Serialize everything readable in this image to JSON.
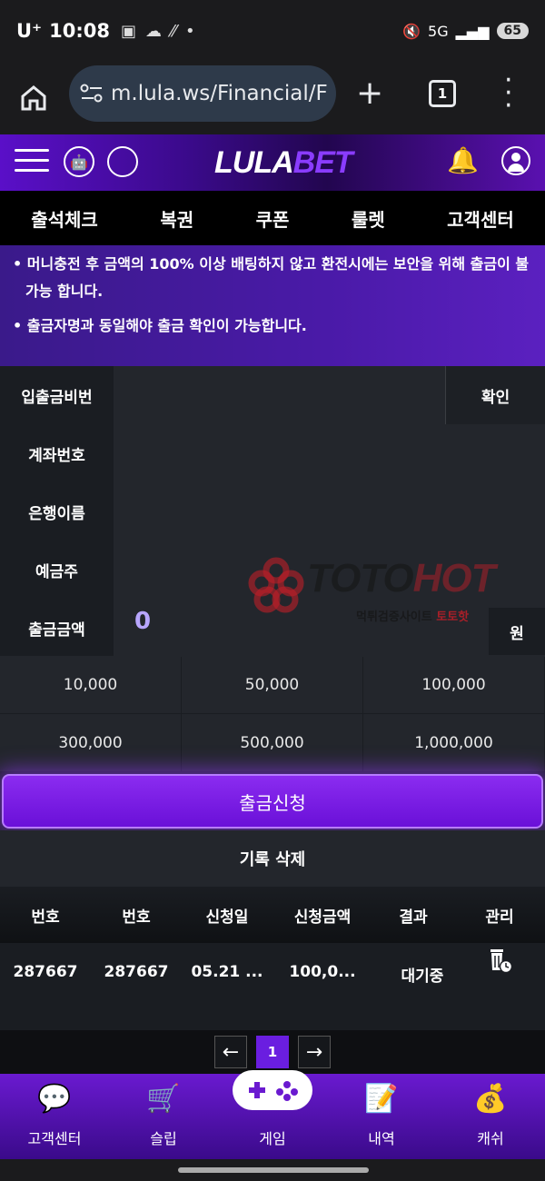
{
  "status": {
    "carrier": "U⁺",
    "time": "10:08",
    "network": "5G",
    "battery": "65"
  },
  "browser": {
    "url": "m.lula.ws/Financial/F",
    "tab_count": "1"
  },
  "header": {
    "logo_left": "LULA",
    "logo_right": "BET"
  },
  "nav": [
    "출석체크",
    "복권",
    "쿠폰",
    "룰렛",
    "고객센터"
  ],
  "notices": [
    "• 머니충전 후 금액의 100% 이상 배팅하지 않고 환전시에는 보안을 위해 출금이 불가능 합니다.",
    "• 출금자명과 동일해야 출금 확인이 가능합니다."
  ],
  "form": {
    "pin_label": "입출금비번",
    "confirm_label": "확인",
    "account_label": "계좌번호",
    "bank_label": "은행이름",
    "holder_label": "예금주",
    "amount_label": "출금금액",
    "amount_value": "0",
    "won_label": "원"
  },
  "watermark": {
    "brand_a": "TOTO",
    "brand_b": "HOT",
    "sub_a": "먹튀검증사이트 ",
    "sub_b": "토토핫"
  },
  "amounts": [
    "10,000",
    "50,000",
    "100,000",
    "300,000",
    "500,000",
    "1,000,000"
  ],
  "submit_label": "출금신청",
  "delete_label": "기록 삭제",
  "table": {
    "headers": [
      "번호",
      "번호",
      "신청일",
      "신청금액",
      "결과",
      "관리"
    ],
    "rows": [
      [
        "287667",
        "287667",
        "05.21 ...",
        "100,0...",
        "대기중"
      ]
    ]
  },
  "pager": {
    "current": "1"
  },
  "bottom_nav": [
    "고객센터",
    "슬립",
    "게임",
    "내역",
    "캐쉬"
  ]
}
